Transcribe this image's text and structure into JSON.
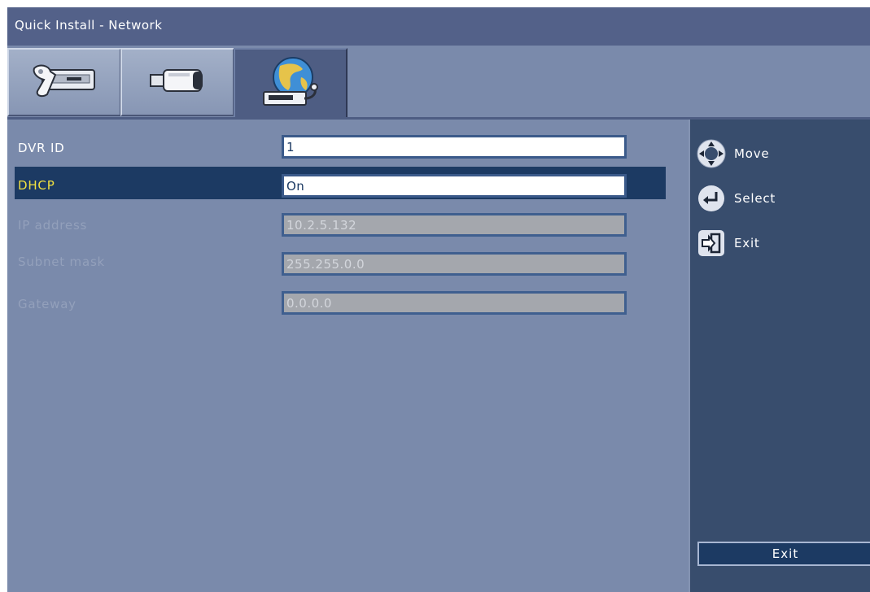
{
  "window": {
    "title": "Quick Install - Network"
  },
  "tabs": [
    {
      "icon": "dvr-settings-icon",
      "active": false
    },
    {
      "icon": "camera-icon",
      "active": false
    },
    {
      "icon": "network-globe-icon",
      "active": true
    }
  ],
  "form": {
    "rows": [
      {
        "label": "DVR ID",
        "value": "1",
        "state": "enabled"
      },
      {
        "label": "DHCP",
        "value": "On",
        "state": "selected"
      },
      {
        "label": "IP address",
        "value": "10.2.5.132",
        "state": "disabled"
      },
      {
        "label": "Subnet mask",
        "value": "255.255.0.0",
        "state": "disabled"
      },
      {
        "label": "Gateway",
        "value": "0.0.0.0",
        "state": "disabled"
      }
    ]
  },
  "hints": [
    {
      "icon": "navigation-pad-icon",
      "label": "Move"
    },
    {
      "icon": "enter-icon",
      "label": "Select"
    },
    {
      "icon": "exit-icon",
      "label": "Exit"
    }
  ],
  "footer": {
    "exit_label": "Exit"
  },
  "colors": {
    "background": "#7a8aab",
    "title_bar": "#536189",
    "side_panel": "#384d6d",
    "selection": "#1c3a63",
    "selected_text": "#f0e040"
  }
}
